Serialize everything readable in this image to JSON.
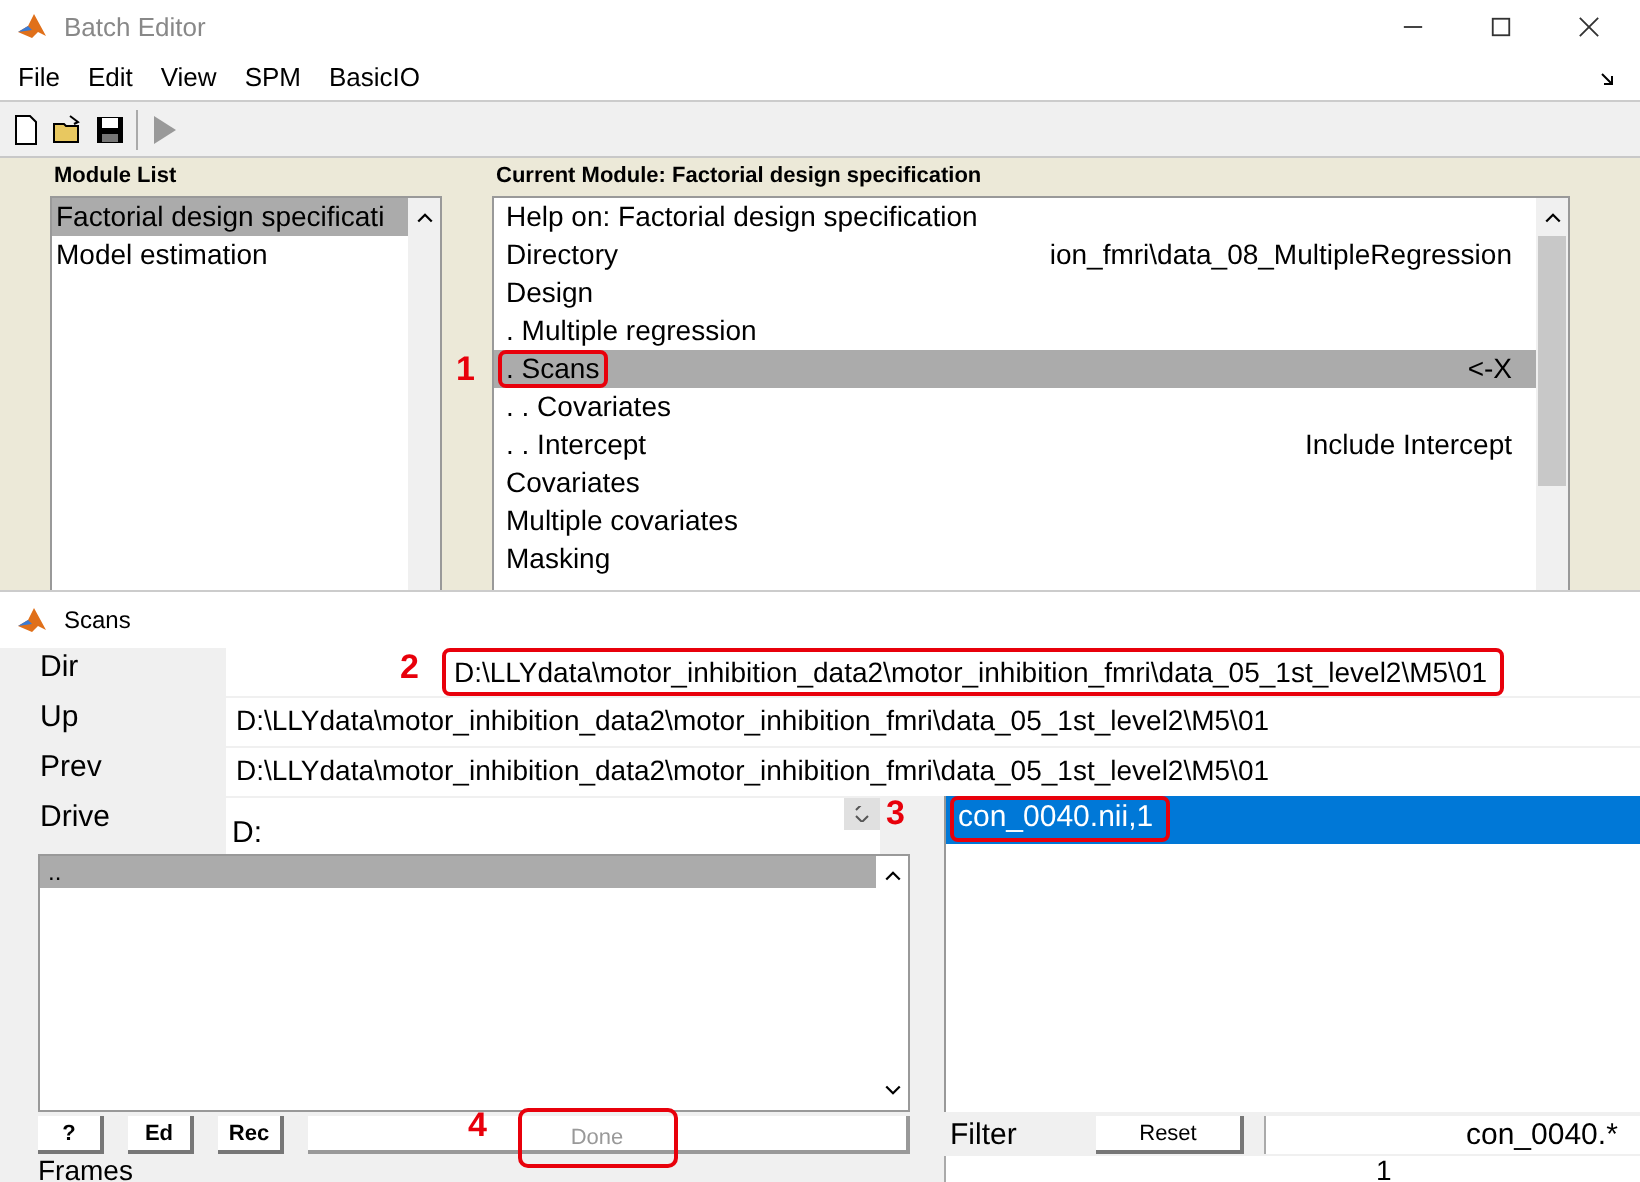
{
  "batch_editor": {
    "title": "Batch Editor",
    "menu": [
      "File",
      "Edit",
      "View",
      "SPM",
      "BasicIO"
    ],
    "module_list": {
      "heading": "Module List",
      "items": [
        {
          "label": "Factorial design specificati",
          "selected": true
        },
        {
          "label": "Model estimation",
          "selected": false
        }
      ]
    },
    "current_module": {
      "heading": "Current Module: Factorial design specification",
      "rows": [
        {
          "label": "Help on: Factorial design specification",
          "selected": false,
          "annotated": false
        },
        {
          "label": "Directory",
          "value": "ion_fmri\\data_08_MultipleRegression",
          "selected": false,
          "annotated": false
        },
        {
          "label": "Design",
          "selected": false,
          "annotated": false
        },
        {
          "label": ". Multiple regression",
          "selected": false,
          "annotated": false
        },
        {
          "label": ". Scans",
          "value": "<-X",
          "selected": true,
          "annotated": true,
          "marker": "1"
        },
        {
          "label": ". . Covariates",
          "selected": false,
          "annotated": false
        },
        {
          "label": ". . Intercept",
          "value": "Include Intercept",
          "selected": false,
          "annotated": false
        },
        {
          "label": "Covariates",
          "selected": false,
          "annotated": false
        },
        {
          "label": "Multiple covariates",
          "selected": false,
          "annotated": false
        },
        {
          "label": "Masking",
          "selected": false,
          "annotated": false
        }
      ]
    }
  },
  "scans": {
    "title": "Scans",
    "paths": [
      {
        "label": "Dir",
        "value": "D:\\LLYdata\\motor_inhibition_data2\\motor_inhibition_fmri\\data_05_1st_level2\\M5\\01",
        "annotated": true,
        "marker": "2"
      },
      {
        "label": "Up",
        "value": "D:\\LLYdata\\motor_inhibition_data2\\motor_inhibition_fmri\\data_05_1st_level2\\M5\\01",
        "annotated": false
      },
      {
        "label": "Prev",
        "value": "D:\\LLYdata\\motor_inhibition_data2\\motor_inhibition_fmri\\data_05_1st_level2\\M5\\01",
        "annotated": false
      }
    ],
    "drive": {
      "label": "Drive",
      "value": "D:"
    },
    "directories": [
      {
        "label": "..",
        "selected": true
      }
    ],
    "files": [
      {
        "label": "con_0040.nii,1",
        "selected": true,
        "annotated": true,
        "marker": "3"
      }
    ],
    "buttons": [
      "?",
      "Ed",
      "Rec"
    ],
    "done": {
      "label": "Done",
      "disabled": true,
      "annotated": true,
      "marker": "4"
    },
    "filter": {
      "label": "Filter",
      "reset": "Reset",
      "value": "con_0040.*"
    },
    "frames": {
      "label": "Frames",
      "value": "1"
    }
  }
}
